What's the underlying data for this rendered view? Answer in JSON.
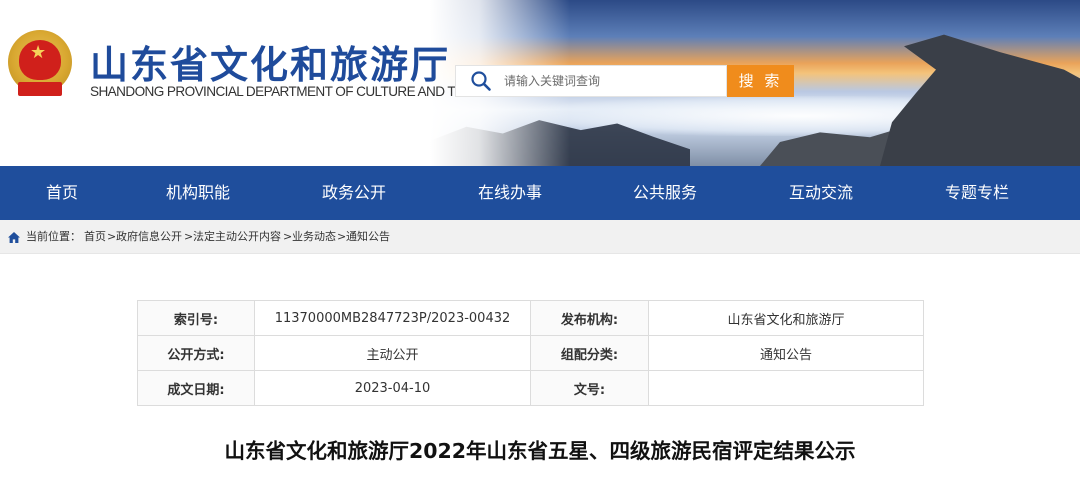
{
  "header": {
    "title": "山东省文化和旅游厅",
    "subtitle": "SHANDONG PROVINCIAL DEPARTMENT OF CULTURE AND TOURISM",
    "search_placeholder": "请输入关键词查询",
    "search_button": "搜 索"
  },
  "nav": {
    "items": [
      {
        "label": "首页"
      },
      {
        "label": "机构职能"
      },
      {
        "label": "政务公开"
      },
      {
        "label": "在线办事"
      },
      {
        "label": "公共服务"
      },
      {
        "label": "互动交流"
      },
      {
        "label": "专题专栏"
      }
    ]
  },
  "breadcrumb": {
    "prefix": "当前位置：",
    "items": [
      "首页",
      "政府信息公开",
      "法定主动公开内容",
      "业务动态",
      "通知公告"
    ],
    "separator": ">"
  },
  "info": {
    "rows": [
      {
        "k1": "索引号:",
        "v1": "11370000MB2847723P/2023-00432",
        "k2": "发布机构:",
        "v2": "山东省文化和旅游厅"
      },
      {
        "k1": "公开方式:",
        "v1": "主动公开",
        "k2": "组配分类:",
        "v2": "通知公告"
      },
      {
        "k1": "成文日期:",
        "v1": "2023-04-10",
        "k2": "文号:",
        "v2": ""
      }
    ]
  },
  "document": {
    "title": "山东省文化和旅游厅2022年山东省五星、四级旅游民宿评定结果公示"
  },
  "colors": {
    "brand_blue": "#1f4e9c",
    "title_blue": "#1f4b9b",
    "search_orange": "#f08c1c"
  },
  "icons": [
    "national-emblem-icon",
    "search-icon",
    "home-icon"
  ]
}
